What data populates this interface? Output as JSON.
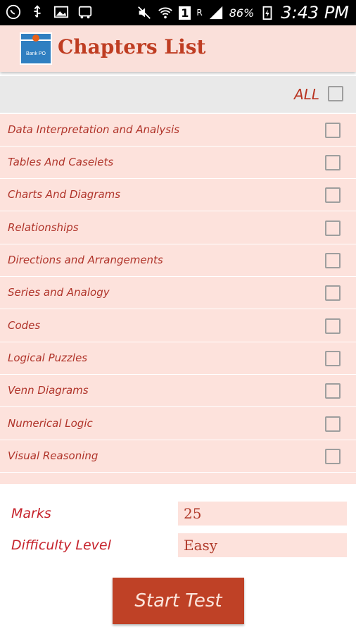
{
  "statusbar": {
    "time": "3:43 PM",
    "battery": "86%",
    "sim": "1",
    "roaming": "R"
  },
  "appbar": {
    "title": "Chapters List",
    "logo_top": "",
    "logo_text": "Bank PO"
  },
  "select_all": {
    "label": "ALL",
    "checked": false
  },
  "chapters": [
    {
      "label": "Data Interpretation and Analysis",
      "checked": false
    },
    {
      "label": "Tables And Caselets",
      "checked": false
    },
    {
      "label": "Charts And Diagrams",
      "checked": false
    },
    {
      "label": "Relationships",
      "checked": false
    },
    {
      "label": "Directions and Arrangements",
      "checked": false
    },
    {
      "label": "Series and Analogy",
      "checked": false
    },
    {
      "label": "Codes",
      "checked": false
    },
    {
      "label": "Logical Puzzles",
      "checked": false
    },
    {
      "label": "Venn Diagrams",
      "checked": false
    },
    {
      "label": "Numerical Logic",
      "checked": false
    },
    {
      "label": "Visual Reasoning",
      "checked": false
    }
  ],
  "form": {
    "marks_label": "Marks",
    "marks_value": "25",
    "difficulty_label": "Difficulty Level",
    "difficulty_value": "Easy"
  },
  "start_button": {
    "label": "Start Test"
  },
  "colors": {
    "accent": "#bf4126",
    "list_bg": "#fde2dc",
    "text_red": "#b0342a"
  }
}
